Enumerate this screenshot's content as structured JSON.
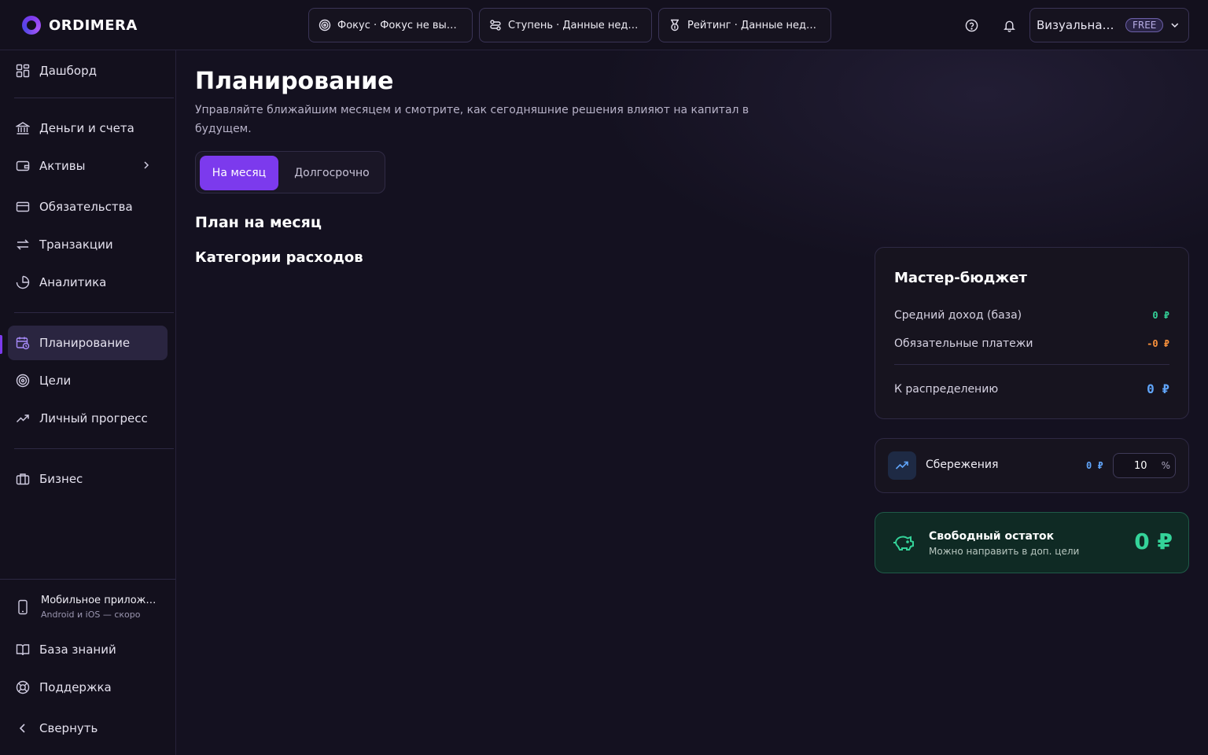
{
  "brand": {
    "name": "ORDIMERA"
  },
  "topbar": {
    "focus_pill": "Фокус · Фокус не выбран",
    "stage_pill": "Ступень · Данные недос...",
    "rating_pill": "Рейтинг · Данные недос...",
    "account_name": "Визуальная ...",
    "plan_badge": "FREE"
  },
  "sidebar": {
    "items": [
      {
        "label": "Дашборд"
      },
      {
        "label": "Деньги и счета"
      },
      {
        "label": "Активы"
      },
      {
        "label": "Обязательства"
      },
      {
        "label": "Транзакции"
      },
      {
        "label": "Аналитика"
      },
      {
        "label": "Планирование"
      },
      {
        "label": "Цели"
      },
      {
        "label": "Личный прогресс"
      },
      {
        "label": "Бизнес"
      }
    ],
    "mobile_title": "Мобильное приложе...",
    "mobile_sub": "Android и iOS — скоро",
    "knowledge": "База знаний",
    "support": "Поддержка",
    "collapse": "Свернуть"
  },
  "main": {
    "title": "Планирование",
    "subtitle": "Управляйте ближайшим месяцем и смотрите, как сегодняшние решения влияют на капитал в будущем.",
    "tabs": [
      {
        "label": "На месяц"
      },
      {
        "label": "Долгосрочно"
      }
    ],
    "section_title": "План на месяц",
    "categories_title": "Категории расходов"
  },
  "budget": {
    "title": "Мастер-бюджет",
    "income_label": "Средний доход (база)",
    "income_value": "0 ₽",
    "mandatory_label": "Обязательные платежи",
    "mandatory_value": "-0 ₽",
    "distribute_label": "К распределению",
    "distribute_value": "0 ₽"
  },
  "savings": {
    "label": "Сбережения",
    "value": "0 ₽",
    "percent": "10",
    "percent_sign": "%"
  },
  "free_balance": {
    "title": "Свободный остаток",
    "subtitle": "Можно направить в доп. цели",
    "value": "0 ₽"
  },
  "colors": {
    "accent": "#7c3aed",
    "positive": "#34d399",
    "negative": "#fb923c",
    "info": "#60a5fa"
  }
}
